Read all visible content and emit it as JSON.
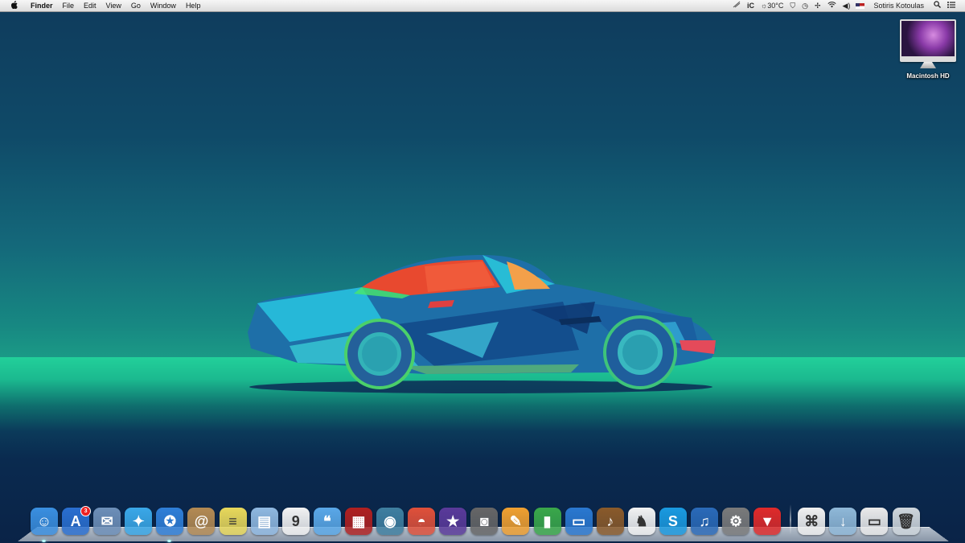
{
  "menubar": {
    "apple": "",
    "app_name": "Finder",
    "menus": [
      "File",
      "Edit",
      "View",
      "Go",
      "Window",
      "Help"
    ],
    "status": {
      "istat": "iC",
      "weather": "30°C",
      "user": "Sotiris Kotoulas"
    }
  },
  "desktop": {
    "icons": [
      {
        "label": "Macintosh HD",
        "icon": "imac-icon"
      }
    ]
  },
  "dock": {
    "apps": [
      {
        "name": "finder-icon",
        "color": "#3a8fe0",
        "glyph": "☺"
      },
      {
        "name": "app-store-icon",
        "color": "#2a6fd0",
        "glyph": "A",
        "badge": "3"
      },
      {
        "name": "mail-stamp-icon",
        "color": "#6d8fb8",
        "glyph": "✉"
      },
      {
        "name": "twitter-icon",
        "color": "#3aa8e8",
        "glyph": "✦"
      },
      {
        "name": "safari-icon",
        "color": "#2f7fd8",
        "glyph": "✪"
      },
      {
        "name": "contacts-icon",
        "color": "#b48a52",
        "glyph": "@"
      },
      {
        "name": "notes-icon",
        "color": "#e8d85a",
        "glyph": "≡"
      },
      {
        "name": "preview-icon",
        "color": "#8fb8e0",
        "glyph": "▤"
      },
      {
        "name": "calendar-icon",
        "color": "#f2f2f2",
        "glyph": "9"
      },
      {
        "name": "messages-icon",
        "color": "#5aa8e8",
        "glyph": "❝"
      },
      {
        "name": "photo-booth-icon",
        "color": "#b02020",
        "glyph": "▦"
      },
      {
        "name": "iphoto-icon",
        "color": "#3f7fa0",
        "glyph": "◉"
      },
      {
        "name": "sunrise-icon",
        "color": "#e0503a",
        "glyph": "◓"
      },
      {
        "name": "imovie-icon",
        "color": "#5a3a9a",
        "glyph": "★"
      },
      {
        "name": "facetime-icon",
        "color": "#666666",
        "glyph": "◙"
      },
      {
        "name": "pages-icon",
        "color": "#f0a030",
        "glyph": "✎"
      },
      {
        "name": "numbers-icon",
        "color": "#3aa84a",
        "glyph": "▮"
      },
      {
        "name": "keynote-icon",
        "color": "#2a78d0",
        "glyph": "▭"
      },
      {
        "name": "garageband-icon",
        "color": "#8a5a2a",
        "glyph": "♪"
      },
      {
        "name": "podcast-icon",
        "color": "#f2f2f2",
        "glyph": "♞"
      },
      {
        "name": "skype-icon",
        "color": "#1a9ae0",
        "glyph": "S"
      },
      {
        "name": "itunes-icon",
        "color": "#2a6ab8",
        "glyph": "♫"
      },
      {
        "name": "system-preferences-icon",
        "color": "#7a7a7a",
        "glyph": "⚙"
      },
      {
        "name": "popcorn-time-icon",
        "color": "#e02a2a",
        "glyph": "▼"
      }
    ],
    "stacks": [
      {
        "name": "pdf-document-icon",
        "color": "#f0f0f0",
        "glyph": "⌘"
      },
      {
        "name": "downloads-folder-icon",
        "color": "#8fb8d8",
        "glyph": "↓"
      },
      {
        "name": "screenshot-icon",
        "color": "#eaeaea",
        "glyph": "▭"
      },
      {
        "name": "trash-icon",
        "color": "#cfd6dc",
        "glyph": "🗑"
      }
    ]
  }
}
